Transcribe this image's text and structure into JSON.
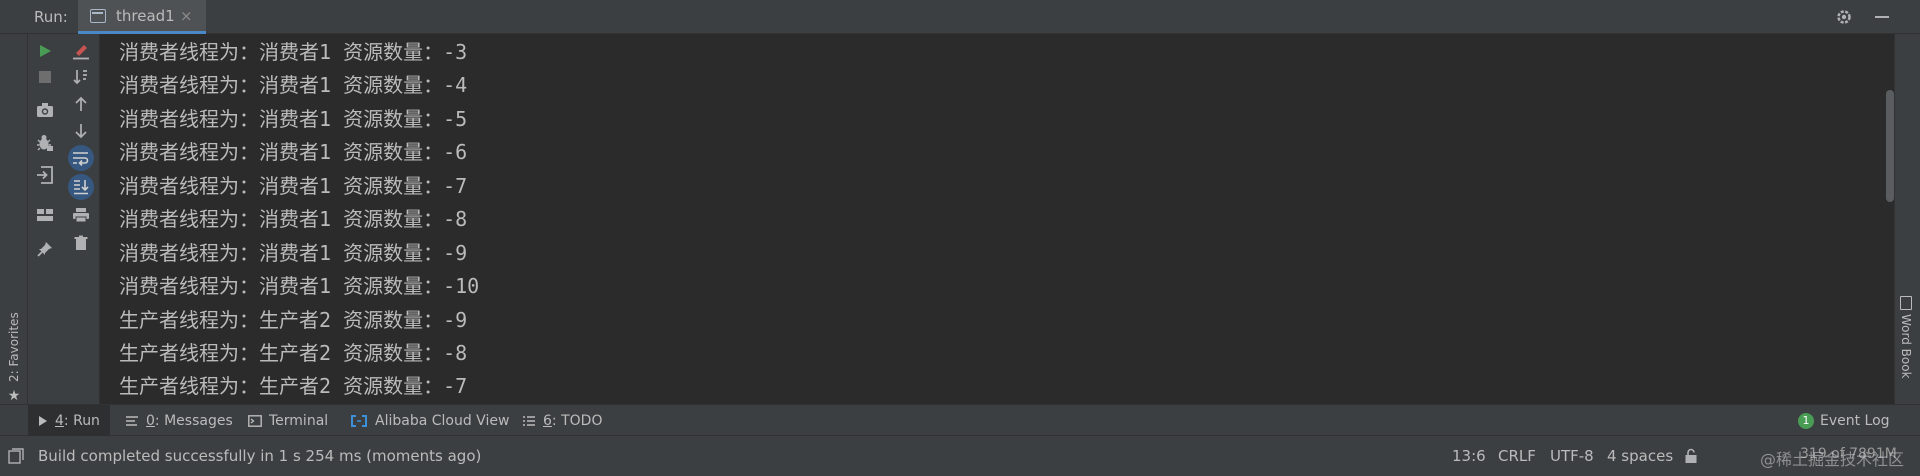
{
  "header": {
    "run_label": "Run:",
    "tab": {
      "label": "thread1",
      "close": "×"
    }
  },
  "left_stripe": {
    "favorites_label": "2: Favorites"
  },
  "right_stripe": {
    "wordbook_label": "Word Book"
  },
  "console": {
    "lines": [
      "消费者线程为：消费者1 资源数量：-3",
      "消费者线程为：消费者1 资源数量：-4",
      "消费者线程为：消费者1 资源数量：-5",
      "消费者线程为：消费者1 资源数量：-6",
      "消费者线程为：消费者1 资源数量：-7",
      "消费者线程为：消费者1 资源数量：-8",
      "消费者线程为：消费者1 资源数量：-9",
      "消费者线程为：消费者1 资源数量：-10",
      "生产者线程为：生产者2 资源数量：-9",
      "生产者线程为：生产者2 资源数量：-8",
      "生产者线程为：生产者2 资源数量：-7"
    ]
  },
  "bottom_tabs": {
    "run": {
      "mnemonic": "4",
      "rest": ": Run"
    },
    "messages": {
      "mnemonic": "0",
      "rest": ": Messages"
    },
    "terminal": {
      "label": "Terminal"
    },
    "alibaba": {
      "label": "Alibaba Cloud View"
    },
    "todo": {
      "mnemonic": "6",
      "rest": ": TODO"
    },
    "event_log": {
      "badge": "1",
      "label": "Event Log"
    }
  },
  "status": {
    "message": "Build completed successfully in 1 s 254 ms (moments ago)",
    "position": "13:6",
    "line_sep": "CRLF",
    "encoding": "UTF-8",
    "indent": "4 spaces",
    "watermark": "@稀土掘金技术社区",
    "memory": "319 of 7891M"
  },
  "colors": {
    "accent": "#4a88c7",
    "run_green": "#499c54",
    "active_button": "#365880"
  }
}
